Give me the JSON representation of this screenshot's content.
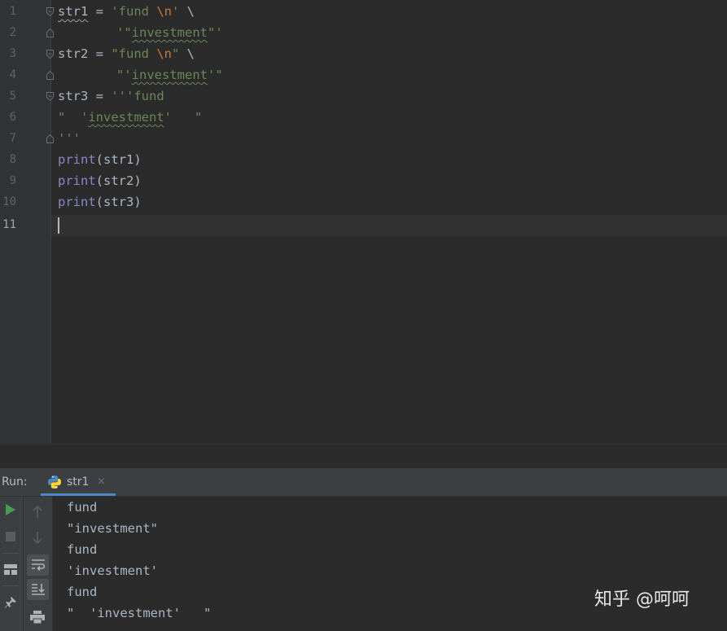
{
  "editor": {
    "line_numbers": [
      "1",
      "2",
      "3",
      "4",
      "5",
      "6",
      "7",
      "8",
      "9",
      "10",
      "11"
    ],
    "code": {
      "l1_name": "str1",
      "l1_eq": " = ",
      "l1_q1": "'fund ",
      "l1_esc": "\\n",
      "l1_q2": "'",
      "l1_cont": " \\",
      "l2_q1": "'\"",
      "l2_word": "investment",
      "l2_q2": "\"'",
      "l3_name": "str2",
      "l3_eq": " = ",
      "l3_q1": "\"fund ",
      "l3_esc": "\\n",
      "l3_q2": "\"",
      "l3_cont": " \\",
      "l4_q1": "\"'",
      "l4_word": "investment",
      "l4_q2": "'\"",
      "l5_name": "str3",
      "l5_eq": " = ",
      "l5_str": "'''fund",
      "l6_q1": "\"  '",
      "l6_word": "investment",
      "l6_q2": "'   \"",
      "l7_str": "'''",
      "l8_fn": "print",
      "l8_args": "(str1)",
      "l9_fn": "print",
      "l9_args": "(str2)",
      "l10_fn": "print",
      "l10_args": "(str3)"
    }
  },
  "run_panel": {
    "title": "Run:",
    "tab_label": "str1",
    "tab_close": "×",
    "output_lines": [
      "fund",
      "\"investment\"",
      "fund",
      "'investment'",
      "fund",
      "\"  'investment'   \""
    ]
  },
  "watermark": "知乎 @呵呵",
  "colors": {
    "background": "#2b2b2b",
    "gutter": "#313335",
    "string": "#6a8759",
    "escape": "#cc7832",
    "builtin": "#8888c6",
    "default_text": "#a9b7c6",
    "run_icon": "#499c54",
    "tab_underline": "#4a88c7"
  },
  "icons": [
    "python-file-icon",
    "run-icon",
    "stop-icon",
    "layout-icon",
    "pin-icon",
    "up-arrow-icon",
    "down-arrow-icon",
    "soft-wrap-icon",
    "scroll-to-end-icon",
    "print-icon",
    "fold-marker-icon"
  ]
}
